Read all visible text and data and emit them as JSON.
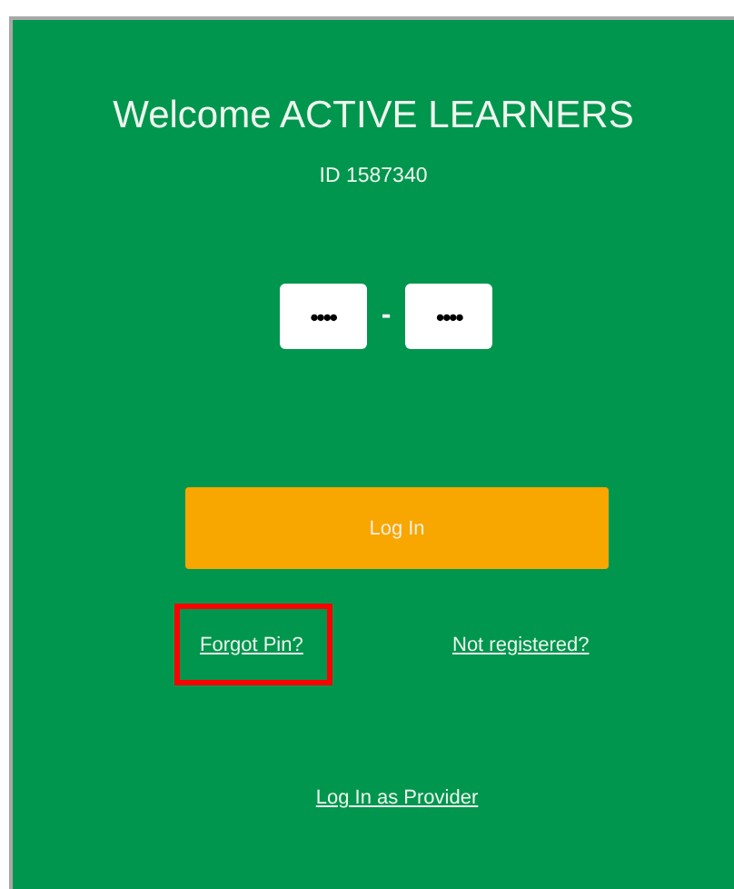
{
  "title": "Welcome ACTIVE LEARNERS",
  "id_text": "ID 1587340",
  "pin_fields": [
    {
      "value": "••••"
    },
    {
      "value": "••••"
    }
  ],
  "pin_separator": "-",
  "login_button": "Log In",
  "links": [
    {
      "label": "Forgot Pin?",
      "highlighted": true
    },
    {
      "label": "Not registered?",
      "highlighted": false
    }
  ],
  "provider_link": "Log In as Provider"
}
